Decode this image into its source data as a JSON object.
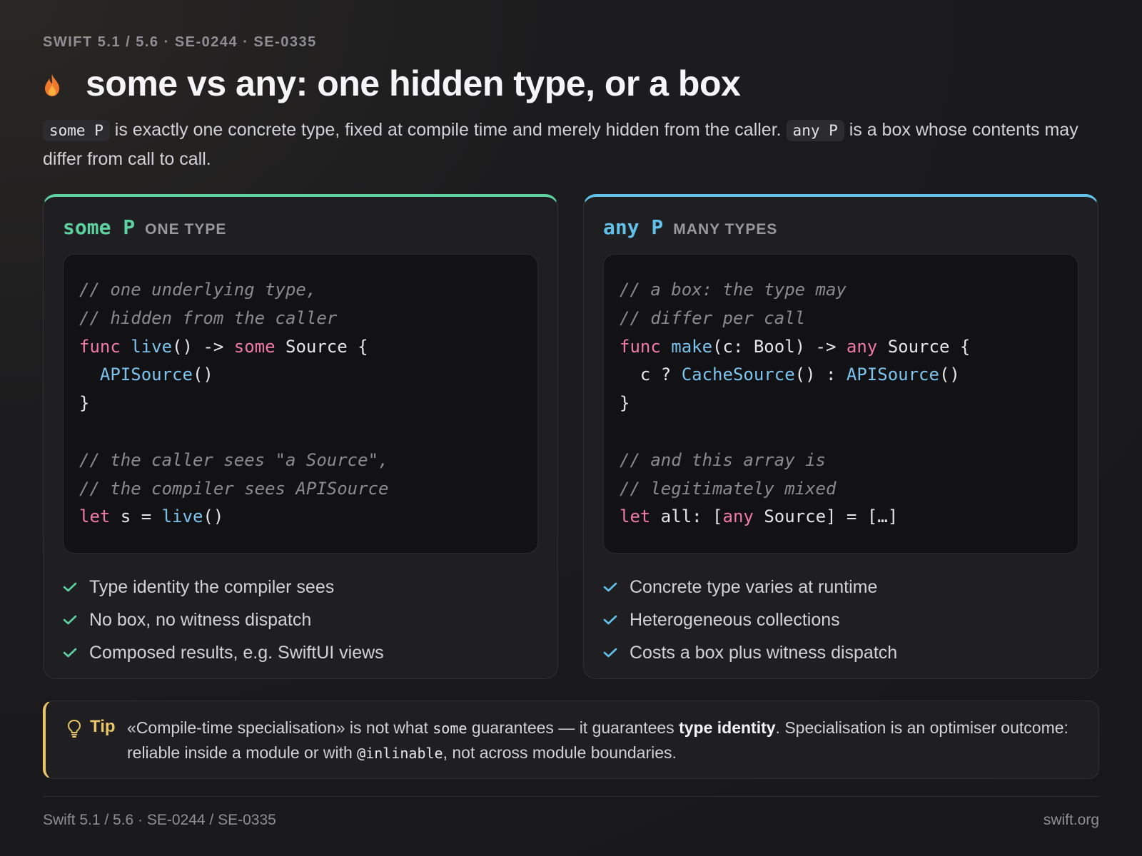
{
  "header": {
    "eyebrow": "SWIFT 5.1 / 5.6 · SE-0244 · SE-0335",
    "icon": "flame-icon",
    "title": "some vs any: one hidden type, or a box"
  },
  "lead": {
    "chip_some": "some P",
    "text_1": " is exactly one concrete type, fixed at compile time and merely hidden from the caller. ",
    "chip_any": "any P",
    "text_2": " is a box whose contents may differ from call to call."
  },
  "cards": {
    "some": {
      "keyword": "some P",
      "subtitle": "ONE TYPE",
      "accent": "#5ed1a0",
      "code": {
        "c1": "// one underlying type,",
        "c2": "// hidden from the caller",
        "l3_func": "func",
        "l3_name": "live",
        "l3_mid": "() -> ",
        "l3_some": "some",
        "l3_end": " Source {",
        "l4_indent": "  ",
        "l4_call": "APISource",
        "l4_end": "()",
        "l5": "}",
        "c7": "// the caller sees \"a Source\",",
        "c8": "// the compiler sees APISource",
        "l9_let": "let",
        "l9_mid": " s = ",
        "l9_call": "live",
        "l9_end": "()"
      },
      "checks": [
        "Type identity the compiler sees",
        "No box, no witness dispatch",
        "Composed results, e.g. SwiftUI views"
      ]
    },
    "any": {
      "keyword": "any P",
      "subtitle": "MANY TYPES",
      "accent": "#62c1e8",
      "code": {
        "c1": "// a box: the type may",
        "c2": "// differ per call",
        "l3_func": "func",
        "l3_name": "make",
        "l3_mid": "(c: Bool) -> ",
        "l3_any": "any",
        "l3_end": " Source {",
        "l4_pre": "  c ? ",
        "l4_call1": "CacheSource",
        "l4_mid": "() : ",
        "l4_call2": "APISource",
        "l4_end": "()",
        "l5": "}",
        "c7": "// and this array is",
        "c8": "// legitimately mixed",
        "l9_let": "let",
        "l9_mid": " all: [",
        "l9_any": "any",
        "l9_end": " Source] = […]"
      },
      "checks": [
        "Concrete type varies at runtime",
        "Heterogeneous collections",
        "Costs a box plus witness dispatch"
      ]
    }
  },
  "tip": {
    "icon": "lightbulb-icon",
    "label": "Tip",
    "t1": "«Compile-time specialisation» is not what ",
    "code1": "some",
    "t2": " guarantees — it guarantees ",
    "bold": "type identity",
    "t3": ". Specialisation is an optimiser outcome: reliable inside a module or with ",
    "code2": "@inlinable",
    "t4": ", not across module boundaries."
  },
  "footer": {
    "left": "Swift 5.1 / 5.6 · SE-0244 / SE-0335",
    "right": "swift.org"
  }
}
